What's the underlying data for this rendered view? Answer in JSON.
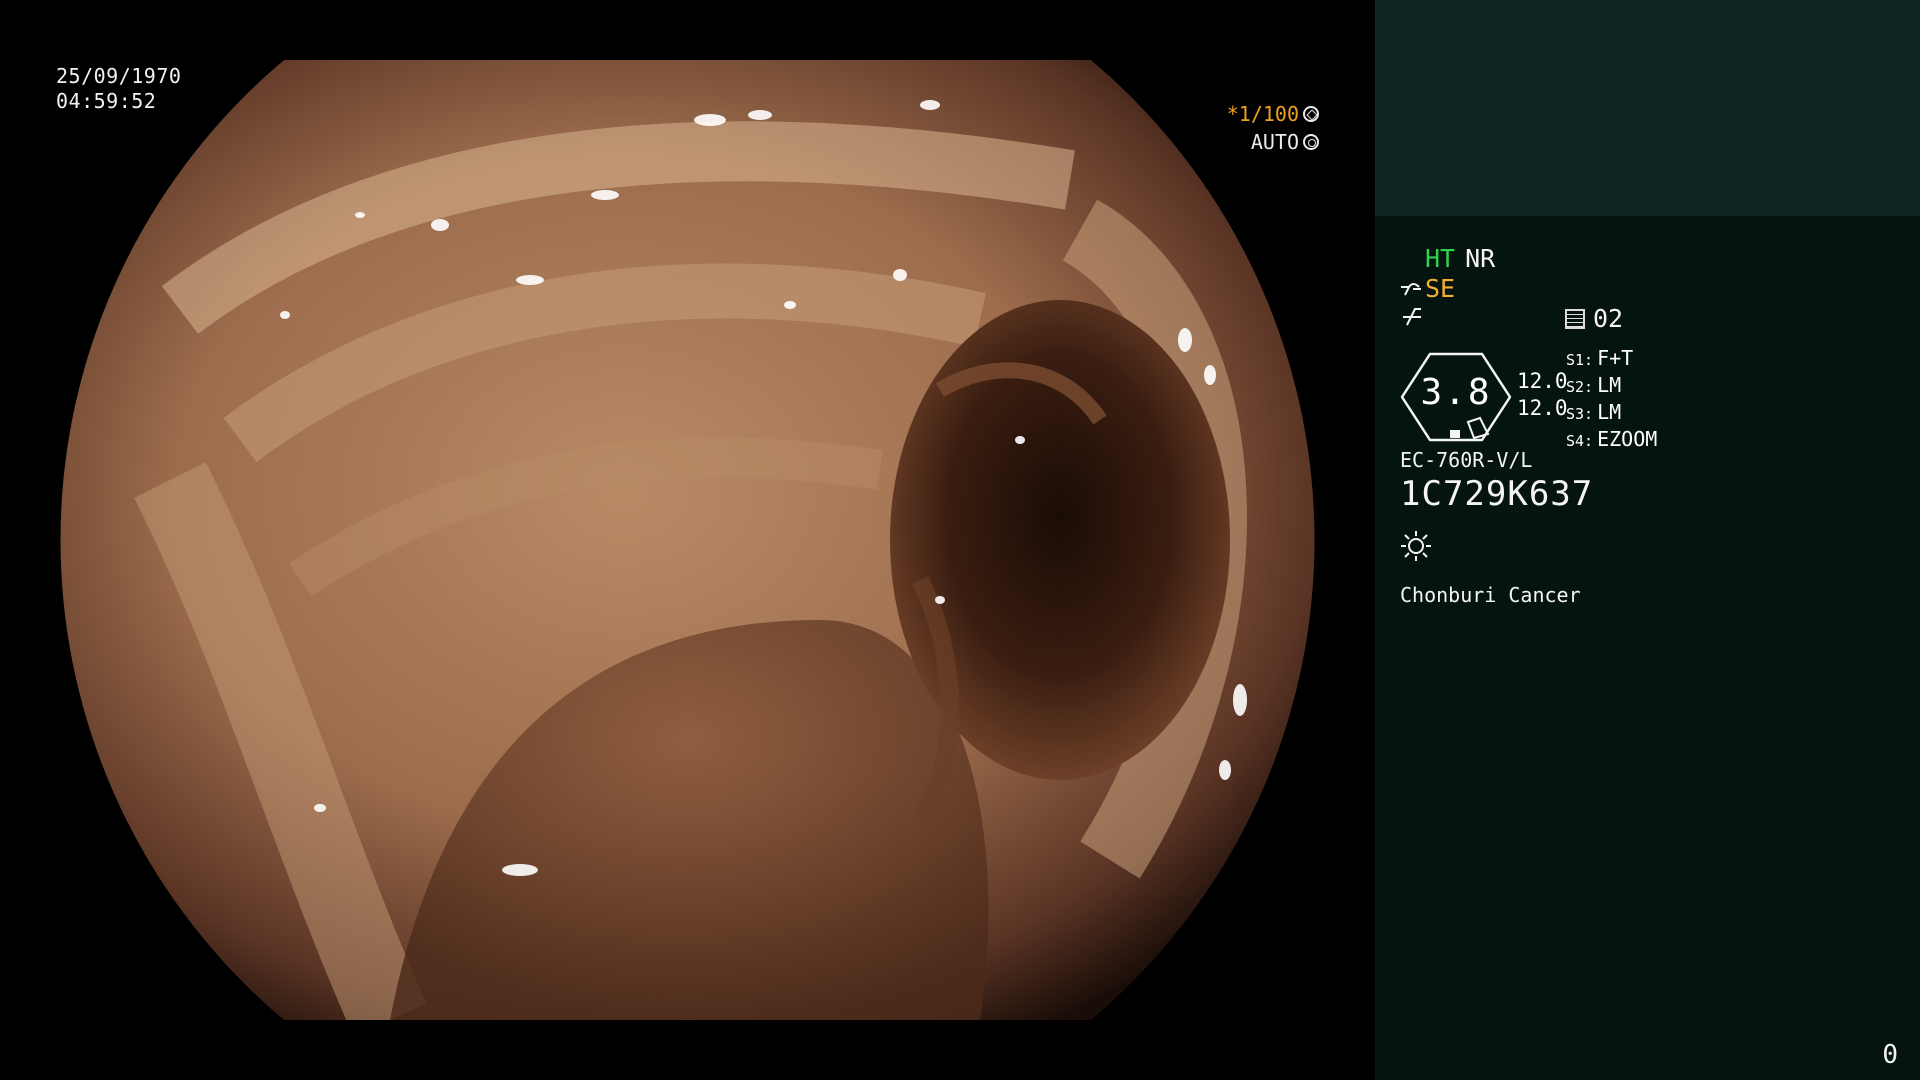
{
  "image_overlay": {
    "date": "25/09/1970",
    "time": "04:59:52",
    "shutter": "*1/100",
    "shutter_icon": "shutter-icon",
    "mode": "AUTO",
    "mode_icon": "iris-icon"
  },
  "info_panel": {
    "ht_label": "HT",
    "nr_label": "NR",
    "se_icon": "enhance-icon",
    "se_label": "SE",
    "struct_icon": "structure-icon",
    "preset_icon": "preset-icon",
    "preset_value": "02",
    "scope_value": "3.8",
    "scope_nums": [
      "12.0",
      "12.0"
    ],
    "switches": [
      {
        "key": "S1:",
        "value": "F+T"
      },
      {
        "key": "S2:",
        "value": "LM"
      },
      {
        "key": "S3:",
        "value": "LM"
      },
      {
        "key": "S4:",
        "value": "EZOOM"
      }
    ],
    "scope_model": "EC-760R-V/L",
    "scope_serial": "1C729K637",
    "light_icon": "light-source-icon",
    "hospital": "Chonburi Cancer",
    "frame_counter": "0"
  },
  "colors": {
    "panel_header": "#0f2624",
    "panel_body": "#061411",
    "ht_green": "#2fd14f",
    "se_amber": "#f0b030",
    "shutter_orange": "#f0a020"
  }
}
